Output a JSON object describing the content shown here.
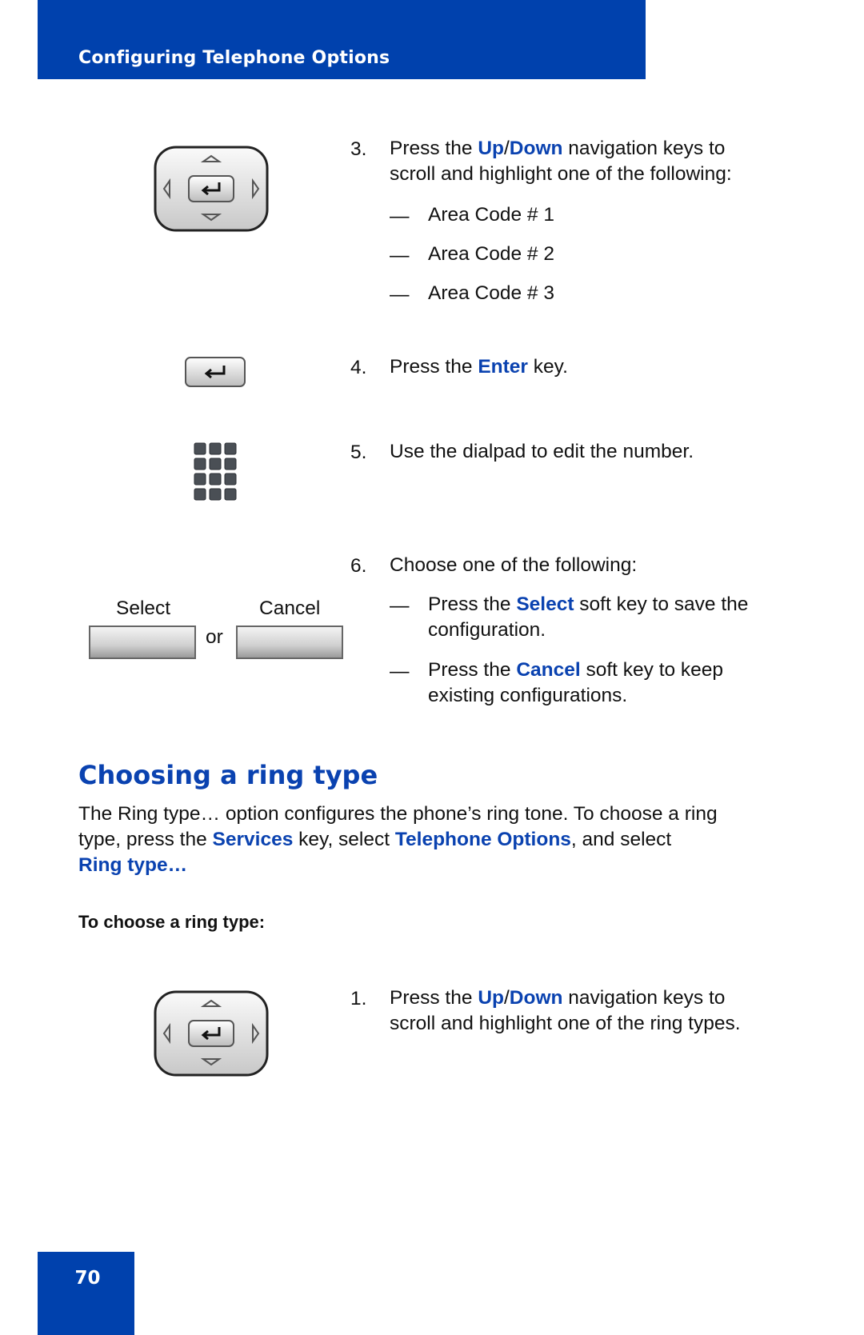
{
  "header": {
    "title": "Configuring Telephone Options"
  },
  "steps_top": [
    {
      "number": "3.",
      "pre": "Press the ",
      "k1": "Up",
      "sep": "/",
      "k2": "Down",
      "post": " navigation keys to",
      "line2": "scroll and highlight one of the following:",
      "options": [
        "Area Code # 1",
        "Area Code # 2",
        "Area Code # 3"
      ]
    },
    {
      "number": "4.",
      "pre": "Press the ",
      "key": "Enter",
      "post": " key."
    },
    {
      "number": "5.",
      "text": "Use the dialpad to edit the number."
    },
    {
      "number": "6.",
      "text": "Choose one of the following:",
      "options": [
        {
          "pre": "Press the ",
          "key": "Select",
          "post": " soft key to save the",
          "line2": "configuration."
        },
        {
          "pre": "Press the ",
          "key": "Cancel",
          "post": " soft key to keep",
          "line2": "existing configurations."
        }
      ]
    }
  ],
  "icons": {
    "nav_cluster": "navigation-cluster-icon",
    "enter_key": "enter-key-icon",
    "dialpad": "dialpad-icon"
  },
  "softkeys": {
    "select_label": "Select",
    "cancel_label": "Cancel",
    "or": "or"
  },
  "section": {
    "title": "Choosing a ring type",
    "para_pre": "The Ring type… option configures the phone’s ring tone. To choose a ring",
    "para_l2_a": "type, press the ",
    "para_services": "Services",
    "para_l2_b": " key, select ",
    "para_telopts": "Telephone Options",
    "para_l2_c": ", and select",
    "para_ringtype": "Ring type…",
    "subheading": "To choose a ring type:",
    "step1": {
      "number": "1.",
      "pre": "Press the ",
      "k1": "Up",
      "sep": "/",
      "k2": "Down",
      "post": " navigation keys to",
      "line2": "scroll and highlight one of the ring types."
    }
  },
  "page_number": "70",
  "colors": {
    "brand_blue": "#0041ad",
    "link_blue": "#0a42b0"
  }
}
